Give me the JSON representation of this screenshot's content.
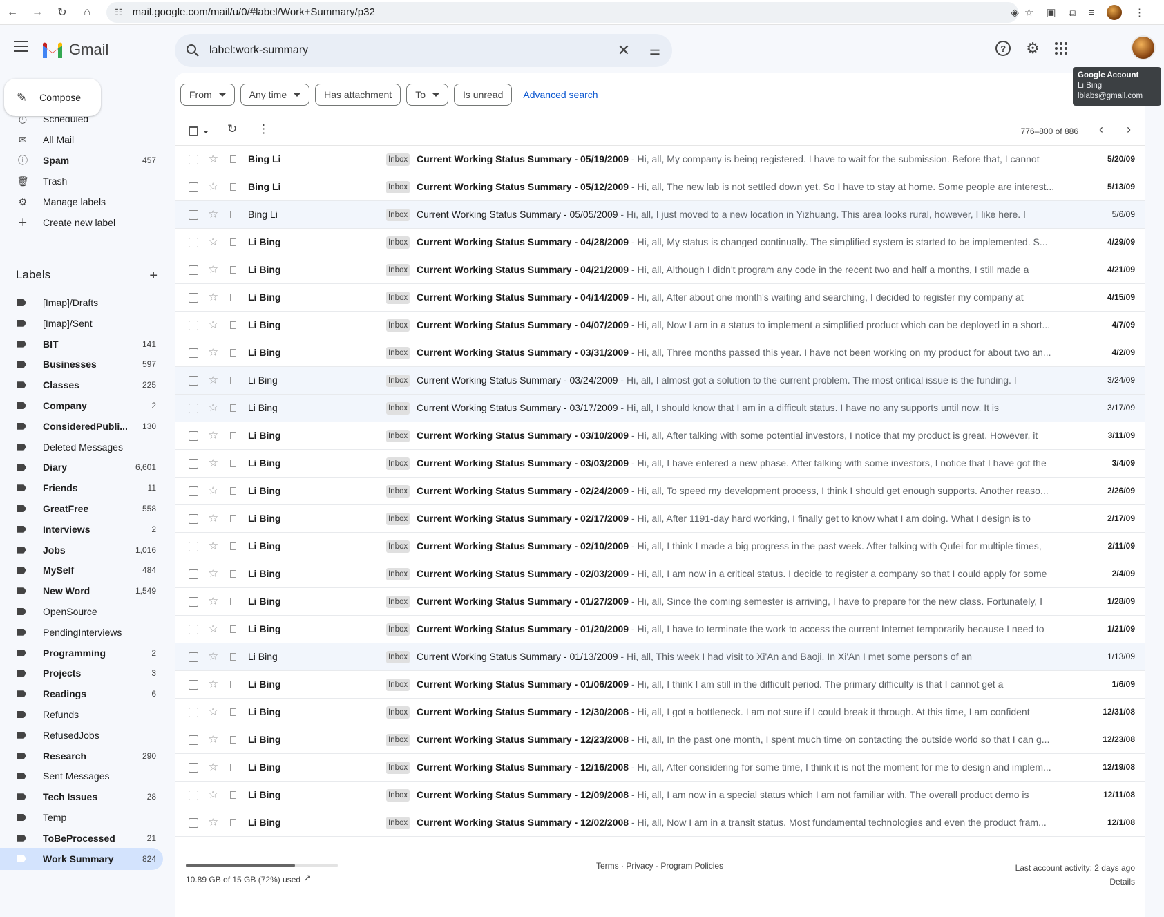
{
  "browser": {
    "url": "mail.google.com/mail/u/0/#label/Work+Summary/p32"
  },
  "header": {
    "app_name": "Gmail",
    "search_query": "label:work-summary"
  },
  "account_tooltip": {
    "title": "Google Account",
    "name": "Li Bing",
    "email": "lblabs@gmail.com"
  },
  "compose_label": "Compose",
  "sidebar": {
    "items": [
      {
        "label": "Scheduled",
        "icon": "scheduled-icon",
        "count": ""
      },
      {
        "label": "All Mail",
        "icon": "all-mail-icon",
        "count": ""
      },
      {
        "label": "Spam",
        "icon": "spam-icon",
        "count": "457"
      },
      {
        "label": "Trash",
        "icon": "trash-icon",
        "count": ""
      },
      {
        "label": "Manage labels",
        "icon": "gear-icon",
        "count": ""
      },
      {
        "label": "Create new label",
        "icon": "plus-icon",
        "count": ""
      }
    ],
    "labels_heading": "Labels",
    "labels": [
      {
        "label": "[Imap]/Drafts",
        "count": ""
      },
      {
        "label": "[Imap]/Sent",
        "count": ""
      },
      {
        "label": "BIT",
        "count": "141"
      },
      {
        "label": "Businesses",
        "count": "597"
      },
      {
        "label": "Classes",
        "count": "225"
      },
      {
        "label": "Company",
        "count": "2"
      },
      {
        "label": "ConsideredPubli...",
        "count": "130"
      },
      {
        "label": "Deleted Messages",
        "count": ""
      },
      {
        "label": "Diary",
        "count": "6,601"
      },
      {
        "label": "Friends",
        "count": "11"
      },
      {
        "label": "GreatFree",
        "count": "558"
      },
      {
        "label": "Interviews",
        "count": "2"
      },
      {
        "label": "Jobs",
        "count": "1,016"
      },
      {
        "label": "MySelf",
        "count": "484"
      },
      {
        "label": "New Word",
        "count": "1,549"
      },
      {
        "label": "OpenSource",
        "count": ""
      },
      {
        "label": "PendingInterviews",
        "count": ""
      },
      {
        "label": "Programming",
        "count": "2"
      },
      {
        "label": "Projects",
        "count": "3"
      },
      {
        "label": "Readings",
        "count": "6"
      },
      {
        "label": "Refunds",
        "count": ""
      },
      {
        "label": "RefusedJobs",
        "count": ""
      },
      {
        "label": "Research",
        "count": "290"
      },
      {
        "label": "Sent Messages",
        "count": ""
      },
      {
        "label": "Tech Issues",
        "count": "28"
      },
      {
        "label": "Temp",
        "count": ""
      },
      {
        "label": "ToBeProcessed",
        "count": "21"
      },
      {
        "label": "Work Summary",
        "count": "824"
      }
    ]
  },
  "filters": {
    "from": "From",
    "any_time": "Any time",
    "has_attachment": "Has attachment",
    "to": "To",
    "is_unread": "Is unread",
    "advanced_search": "Advanced search"
  },
  "pager": "776–800 of 886",
  "emails": [
    {
      "from": "Bing Li",
      "tag": "Inbox",
      "subject": "Current Working Status Summary - 05/19/2009",
      "snippet": " - Hi, all, My company is being registered. I have to wait for the submission. Before that, I cannot",
      "date": "5/20/09",
      "unread": true
    },
    {
      "from": "Bing Li",
      "tag": "Inbox",
      "subject": "Current Working Status Summary - 05/12/2009",
      "snippet": " - Hi, all, The new lab is not settled down yet. So I have to stay at home. Some people are interest...",
      "date": "5/13/09",
      "unread": true
    },
    {
      "from": "Bing Li",
      "tag": "Inbox",
      "subject": "Current Working Status Summary - 05/05/2009",
      "snippet": " - Hi, all, I just moved to a new location in Yizhuang. This area looks rural, however, I like here. I",
      "date": "5/6/09",
      "unread": false
    },
    {
      "from": "Li Bing",
      "tag": "Inbox",
      "subject": "Current Working Status Summary - 04/28/2009",
      "snippet": " - Hi, all, My status is changed continually. The simplified system is started to be implemented. S...",
      "date": "4/29/09",
      "unread": true
    },
    {
      "from": "Li Bing",
      "tag": "Inbox",
      "subject": "Current Working Status Summary - 04/21/2009",
      "snippet": " - Hi, all, Although I didn't program any code in the recent two and half a months, I still made a",
      "date": "4/21/09",
      "unread": true
    },
    {
      "from": "Li Bing",
      "tag": "Inbox",
      "subject": "Current Working Status Summary - 04/14/2009",
      "snippet": " - Hi, all, After about one month's waiting and searching, I decided to register my company at",
      "date": "4/15/09",
      "unread": true
    },
    {
      "from": "Li Bing",
      "tag": "Inbox",
      "subject": "Current Working Status Summary - 04/07/2009",
      "snippet": " - Hi, all, Now I am in a status to implement a simplified product which can be deployed in a short...",
      "date": "4/7/09",
      "unread": true
    },
    {
      "from": "Li Bing",
      "tag": "Inbox",
      "subject": "Current Working Status Summary - 03/31/2009",
      "snippet": " - Hi, all, Three months passed this year. I have not been working on my product for about two an...",
      "date": "4/2/09",
      "unread": true
    },
    {
      "from": "Li Bing",
      "tag": "Inbox",
      "subject": "Current Working Status Summary - 03/24/2009",
      "snippet": " - Hi, all, I almost got a solution to the current problem. The most critical issue is the funding. I",
      "date": "3/24/09",
      "unread": false
    },
    {
      "from": "Li Bing",
      "tag": "Inbox",
      "subject": "Current Working Status Summary - 03/17/2009",
      "snippet": " - Hi, all, I should know that I am in a difficult status. I have no any supports until now. It is",
      "date": "3/17/09",
      "unread": false
    },
    {
      "from": "Li Bing",
      "tag": "Inbox",
      "subject": "Current Working Status Summary - 03/10/2009",
      "snippet": " - Hi, all, After talking with some potential investors, I notice that my product is great. However, it",
      "date": "3/11/09",
      "unread": true
    },
    {
      "from": "Li Bing",
      "tag": "Inbox",
      "subject": "Current Working Status Summary - 03/03/2009",
      "snippet": " - Hi, all, I have entered a new phase. After talking with some investors, I notice that I have got the",
      "date": "3/4/09",
      "unread": true
    },
    {
      "from": "Li Bing",
      "tag": "Inbox",
      "subject": "Current Working Status Summary - 02/24/2009",
      "snippet": " - Hi, all, To speed my development process, I think I should get enough supports. Another reaso...",
      "date": "2/26/09",
      "unread": true
    },
    {
      "from": "Li Bing",
      "tag": "Inbox",
      "subject": "Current Working Status Summary - 02/17/2009",
      "snippet": " - Hi, all, After 1191-day hard working, I finally get to know what I am doing. What I design is to",
      "date": "2/17/09",
      "unread": true
    },
    {
      "from": "Li Bing",
      "tag": "Inbox",
      "subject": "Current Working Status Summary - 02/10/2009",
      "snippet": " - Hi, all, I think I made a big progress in the past week. After talking with Qufei for multiple times,",
      "date": "2/11/09",
      "unread": true
    },
    {
      "from": "Li Bing",
      "tag": "Inbox",
      "subject": "Current Working Status Summary - 02/03/2009",
      "snippet": " - Hi, all, I am now in a critical status. I decide to register a company so that I could apply for some",
      "date": "2/4/09",
      "unread": true
    },
    {
      "from": "Li Bing",
      "tag": "Inbox",
      "subject": "Current Working Status Summary - 01/27/2009",
      "snippet": " - Hi, all, Since the coming semester is arriving, I have to prepare for the new class. Fortunately, I",
      "date": "1/28/09",
      "unread": true
    },
    {
      "from": "Li Bing",
      "tag": "Inbox",
      "subject": "Current Working Status Summary - 01/20/2009",
      "snippet": " - Hi, all, I have to terminate the work to access the current Internet temporarily because I need to",
      "date": "1/21/09",
      "unread": true
    },
    {
      "from": "Li Bing",
      "tag": "Inbox",
      "subject": "Current Working Status Summary - 01/13/2009",
      "snippet": " - Hi, all, This week I had visit to Xi'An and Baoji. In Xi'An I met some persons of an",
      "date": "1/13/09",
      "unread": false
    },
    {
      "from": "Li Bing",
      "tag": "Inbox",
      "subject": "Current Working Status Summary - 01/06/2009",
      "snippet": " - Hi, all, I think I am still in the difficult period. The primary difficulty is that I cannot get a",
      "date": "1/6/09",
      "unread": true
    },
    {
      "from": "Li Bing",
      "tag": "Inbox",
      "subject": "Current Working Status Summary - 12/30/2008",
      "snippet": " - Hi, all, I got a bottleneck. I am not sure if I could break it through. At this time, I am confident",
      "date": "12/31/08",
      "unread": true
    },
    {
      "from": "Li Bing",
      "tag": "Inbox",
      "subject": "Current Working Status Summary - 12/23/2008",
      "snippet": " - Hi, all, In the past one month, I spent much time on contacting the outside world so that I can g...",
      "date": "12/23/08",
      "unread": true
    },
    {
      "from": "Li Bing",
      "tag": "Inbox",
      "subject": "Current Working Status Summary - 12/16/2008",
      "snippet": " - Hi, all, After considering for some time, I think it is not the moment for me to design and implem...",
      "date": "12/19/08",
      "unread": true
    },
    {
      "from": "Li Bing",
      "tag": "Inbox",
      "subject": "Current Working Status Summary - 12/09/2008",
      "snippet": " - Hi, all, I am now in a special status which I am not familiar with. The overall product demo is",
      "date": "12/11/08",
      "unread": true
    },
    {
      "from": "Li Bing",
      "tag": "Inbox",
      "subject": "Current Working Status Summary - 12/02/2008",
      "snippet": " - Hi, all, Now I am in a transit status. Most fundamental technologies and even the product fram...",
      "date": "12/1/08",
      "unread": true
    }
  ],
  "footer": {
    "storage_text": "10.89 GB of 15 GB (72%) used",
    "storage_fraction": 0.72,
    "links": "Terms · Privacy · Program Policies",
    "activity": "Last account activity: 2 days ago",
    "details": "Details"
  }
}
